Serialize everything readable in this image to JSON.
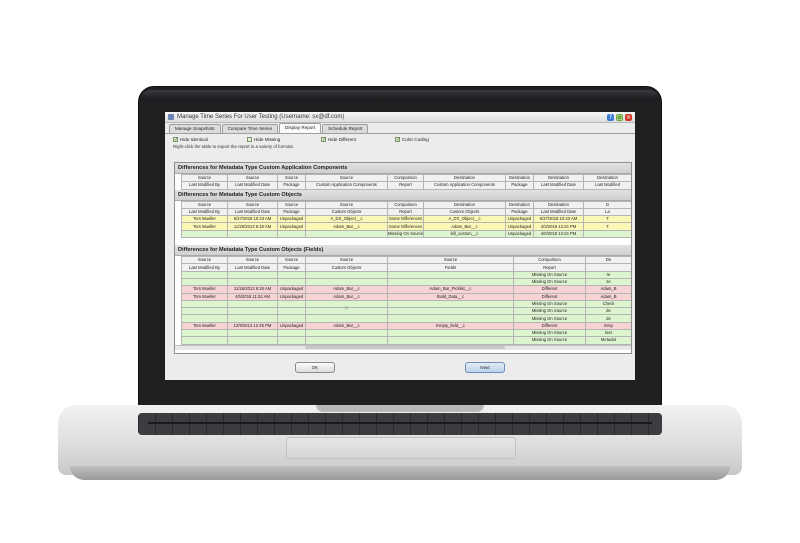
{
  "window": {
    "title": "Manage Time Series For User Testing (Username: sx@df.com)",
    "help_glyph": "?",
    "max_glyph": "□",
    "close_glyph": "×"
  },
  "tabs": [
    {
      "label": "Manage Snapshots"
    },
    {
      "label": "Compare Time Series"
    },
    {
      "label": "Display Report",
      "active": true
    },
    {
      "label": "Schedule Report"
    }
  ],
  "filters": [
    {
      "label": "Hide Identical",
      "checked": true
    },
    {
      "label": "Hide Missing",
      "checked": false
    },
    {
      "label": "Hide Different",
      "checked": true
    },
    {
      "label": "Color Coding",
      "checked": true
    }
  ],
  "hint": "Right-click the table to export the report in a variety of formats.",
  "sections": {
    "app_components": {
      "title": "Differences for Metadata Type Custom Application Components",
      "header1": [
        "Source",
        "Source",
        "Source",
        "Source",
        "Comparison",
        "Destination",
        "Destination",
        "Destination",
        "Destination"
      ],
      "header2": [
        "Last Modified By",
        "Last Modified Date",
        "Package",
        "Custom Application Components",
        "Report",
        "Custom Application Components",
        "Package",
        "Last Modified Date",
        "Last Modified"
      ]
    },
    "custom_objects": {
      "title": "Differences for Metadata Type Custom Objects",
      "header1": [
        "Source",
        "Source",
        "Source",
        "Source",
        "Comparison",
        "Destination",
        "Destination",
        "Destination",
        "D"
      ],
      "header2": [
        "Last Modified By",
        "Last Modified Date",
        "Package",
        "Custom Objects",
        "Report",
        "Custom Objects",
        "Package",
        "Last Modified Date",
        "La"
      ],
      "rows": [
        {
          "tone": "yellow",
          "cells": [
            "Tom Mueller",
            "6/27/2018 10:43 AM",
            "Unpackaged",
            "A_DX_Object__c",
            "Some Differences",
            "A_DX_Object__c",
            "Unpackaged",
            "6/27/2018 10:43 AM",
            "T"
          ]
        },
        {
          "tone": "yellow",
          "cells": [
            "Tom Mueller",
            "11/26/2013 9:18 AM",
            "Unpackaged",
            "Adam_Bar__c",
            "Some Differences",
            "Adam_Bar__c",
            "Unpackaged",
            "4/3/2019 12:24 PM",
            "T"
          ]
        },
        {
          "tone": "green",
          "cells": [
            "",
            "",
            "",
            "",
            "Missing On Source",
            "bill_custom__c",
            "Unpackaged",
            "4/9/2019 12:24 PM",
            ""
          ]
        }
      ]
    },
    "custom_fields": {
      "title": "Differences for Metadata Type Custom Objects (Fields)",
      "header1": [
        "Source",
        "Source",
        "Source",
        "Source",
        "Source",
        "Comparison",
        "De"
      ],
      "header2": [
        "Last Modified By",
        "Last Modified Date",
        "Package",
        "Custom Objects",
        "Fields",
        "Report",
        ""
      ],
      "rows": [
        {
          "tone": "green",
          "cells": [
            "",
            "",
            "",
            "",
            "",
            "Missing On Source",
            "re"
          ]
        },
        {
          "tone": "green",
          "cells": [
            "",
            "",
            "",
            "",
            "",
            "Missing On Source",
            "ze"
          ]
        },
        {
          "tone": "red",
          "cells": [
            "Tom Mueller",
            "11/26/2013 9:18 AM",
            "Unpackaged",
            "Adam_Bar__c",
            "Adam_Bar_Picklist__c",
            "Different",
            "Adam_B"
          ]
        },
        {
          "tone": "red",
          "cells": [
            "Tom Mueller",
            "4/5/2018 11:52 AM",
            "Unpackaged",
            "Adam_Bar__c",
            "Build_Data__c",
            "Different",
            "Adam_B"
          ]
        },
        {
          "tone": "green",
          "cells": [
            "",
            "",
            "",
            "",
            "",
            "Missing On Source",
            "Check"
          ]
        },
        {
          "tone": "green",
          "cells": [
            "",
            "",
            "",
            "",
            "",
            "Missing On Source",
            "de"
          ]
        },
        {
          "tone": "green",
          "cells": [
            "",
            "",
            "",
            "",
            "",
            "Missing On Source",
            "de"
          ]
        },
        {
          "tone": "red",
          "cells": [
            "Tom Mueller",
            "12/9/2013 12:45 PM",
            "Unpackaged",
            "Adam_Bar__c",
            "Empty_field__c",
            "Different",
            "Emp"
          ]
        },
        {
          "tone": "green",
          "cells": [
            "",
            "",
            "",
            "",
            "",
            "Missing On Source",
            "last"
          ]
        },
        {
          "tone": "green",
          "cells": [
            "",
            "",
            "",
            "",
            "",
            "Missing On Source",
            "Metadat"
          ]
        }
      ]
    }
  },
  "buttons": {
    "ok": "OK",
    "next": "Next"
  },
  "colors": {
    "yellow_row": "#fbf7b6",
    "green_row": "#ddf5cf",
    "red_row": "#f7d3d3",
    "laptop_bezel": "#1f2022"
  }
}
